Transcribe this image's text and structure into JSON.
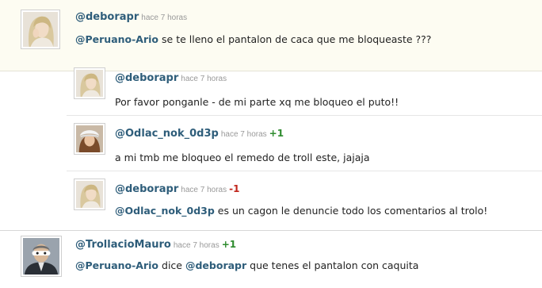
{
  "comments": [
    {
      "user": "@deborapr",
      "time": "hace 7 horas",
      "mention": "@Peruano-Ario",
      "text": "se te lleno el pantalon de caca que me bloqueaste ???"
    },
    {
      "user": "@deborapr",
      "time": "hace 7 horas",
      "text": "Por favor ponganle - de mi parte xq me bloqueo el puto!!"
    },
    {
      "user": "@Odlac_nok_0d3p",
      "time": "hace 7 horas",
      "vote": "+1",
      "text": "a mi tmb me bloqueo el remedo de troll este, jajaja"
    },
    {
      "user": "@deborapr",
      "time": "hace 7 horas",
      "vote": "-1",
      "mention": "@Odlac_nok_0d3p",
      "text": "es un cagon le denuncie todo los comentarios al trolo!"
    },
    {
      "user": "@TrollacioMauro",
      "time": "hace 7 horas",
      "vote": "+1",
      "mention": "@Peruano-Ario",
      "text_mid": "dice",
      "mention2": "@deborapr",
      "text": "que tenes el pantalon con caquita"
    }
  ],
  "colors": {
    "username": "#2e5d7a",
    "positive": "#2e8b2e",
    "negative": "#c0251b",
    "highlight_bg": "#fdfcf2"
  },
  "icons": [
    "avatar-blonde-woman",
    "avatar-woman-white-hat",
    "avatar-man-masked"
  ]
}
